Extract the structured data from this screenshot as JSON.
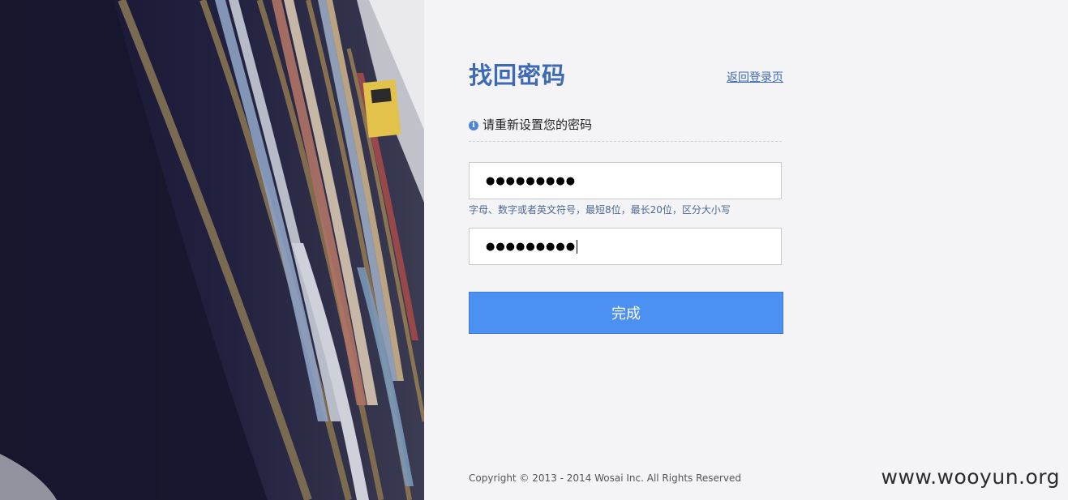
{
  "left_panel": {
    "image": "library-bookshelf-photo"
  },
  "form": {
    "title": "找回密码",
    "back_link": "返回登录页",
    "instruction_icon": "info-icon",
    "instruction": "请重新设置您的密码",
    "password_value": "●●●●●●●●●",
    "password_note": "字母、数字或者英文符号，最短8位，最长20位，区分大小写",
    "confirm_value": "●●●●●●●●●",
    "submit_label": "完成"
  },
  "footer": {
    "copyright": "Copyright © 2013 - 2014 Wosai Inc. All Rights Reserved"
  },
  "watermark": "www.wooyun.org",
  "colors": {
    "title": "#3e6ab3",
    "button": "#4c90f2",
    "background": "#f4f4f6"
  }
}
